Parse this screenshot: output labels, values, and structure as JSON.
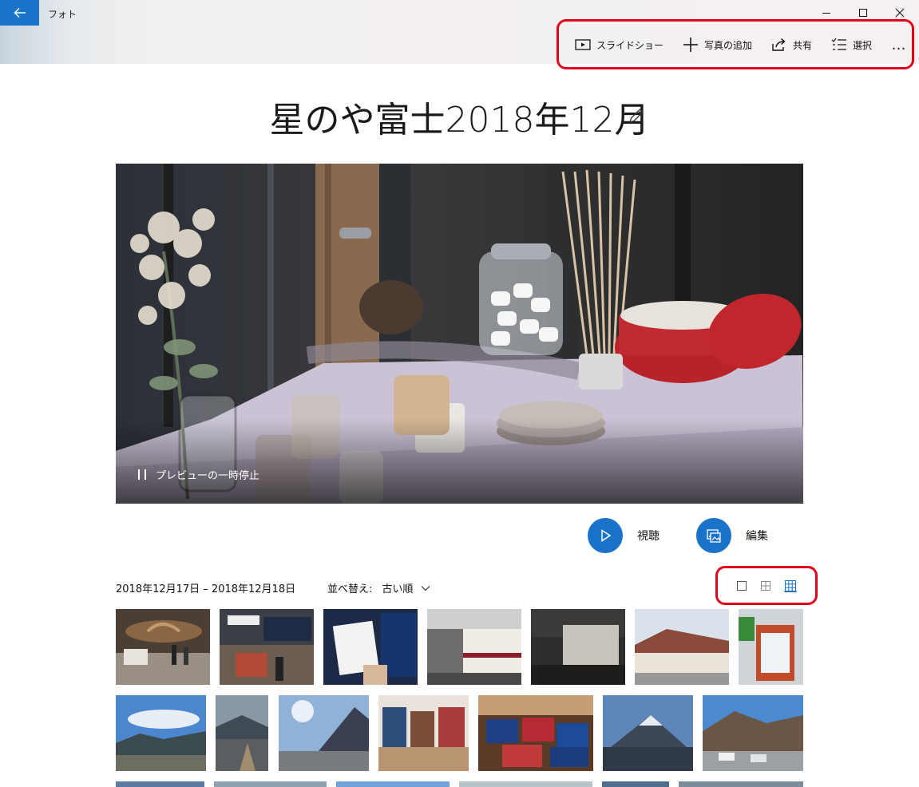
{
  "app": {
    "title": "フォト"
  },
  "toolbar": {
    "slideshow": "スライドショー",
    "add_photos": "写真の追加",
    "share": "共有",
    "select": "選択",
    "more": "…"
  },
  "album": {
    "title": "星のや富士2018年12月",
    "preview_pause": "プレビューの一時停止",
    "watch": "視聴",
    "edit": "編集",
    "date_range": "2018年12月17日 – 2018年12月18日",
    "sort_label": "並べ替え:",
    "sort_value": "古い順"
  },
  "colors": {
    "accent": "#1a73c9",
    "highlight": "#e0001a"
  },
  "icons": [
    "back-arrow-icon",
    "minimize-icon",
    "maximize-icon",
    "close-icon",
    "slideshow-icon",
    "plus-icon",
    "share-icon",
    "select-icon",
    "pencil-icon",
    "pause-icon",
    "play-icon",
    "edit-image-icon",
    "chevron-down-icon",
    "view-large-icon",
    "view-medium-icon",
    "view-small-icon"
  ]
}
